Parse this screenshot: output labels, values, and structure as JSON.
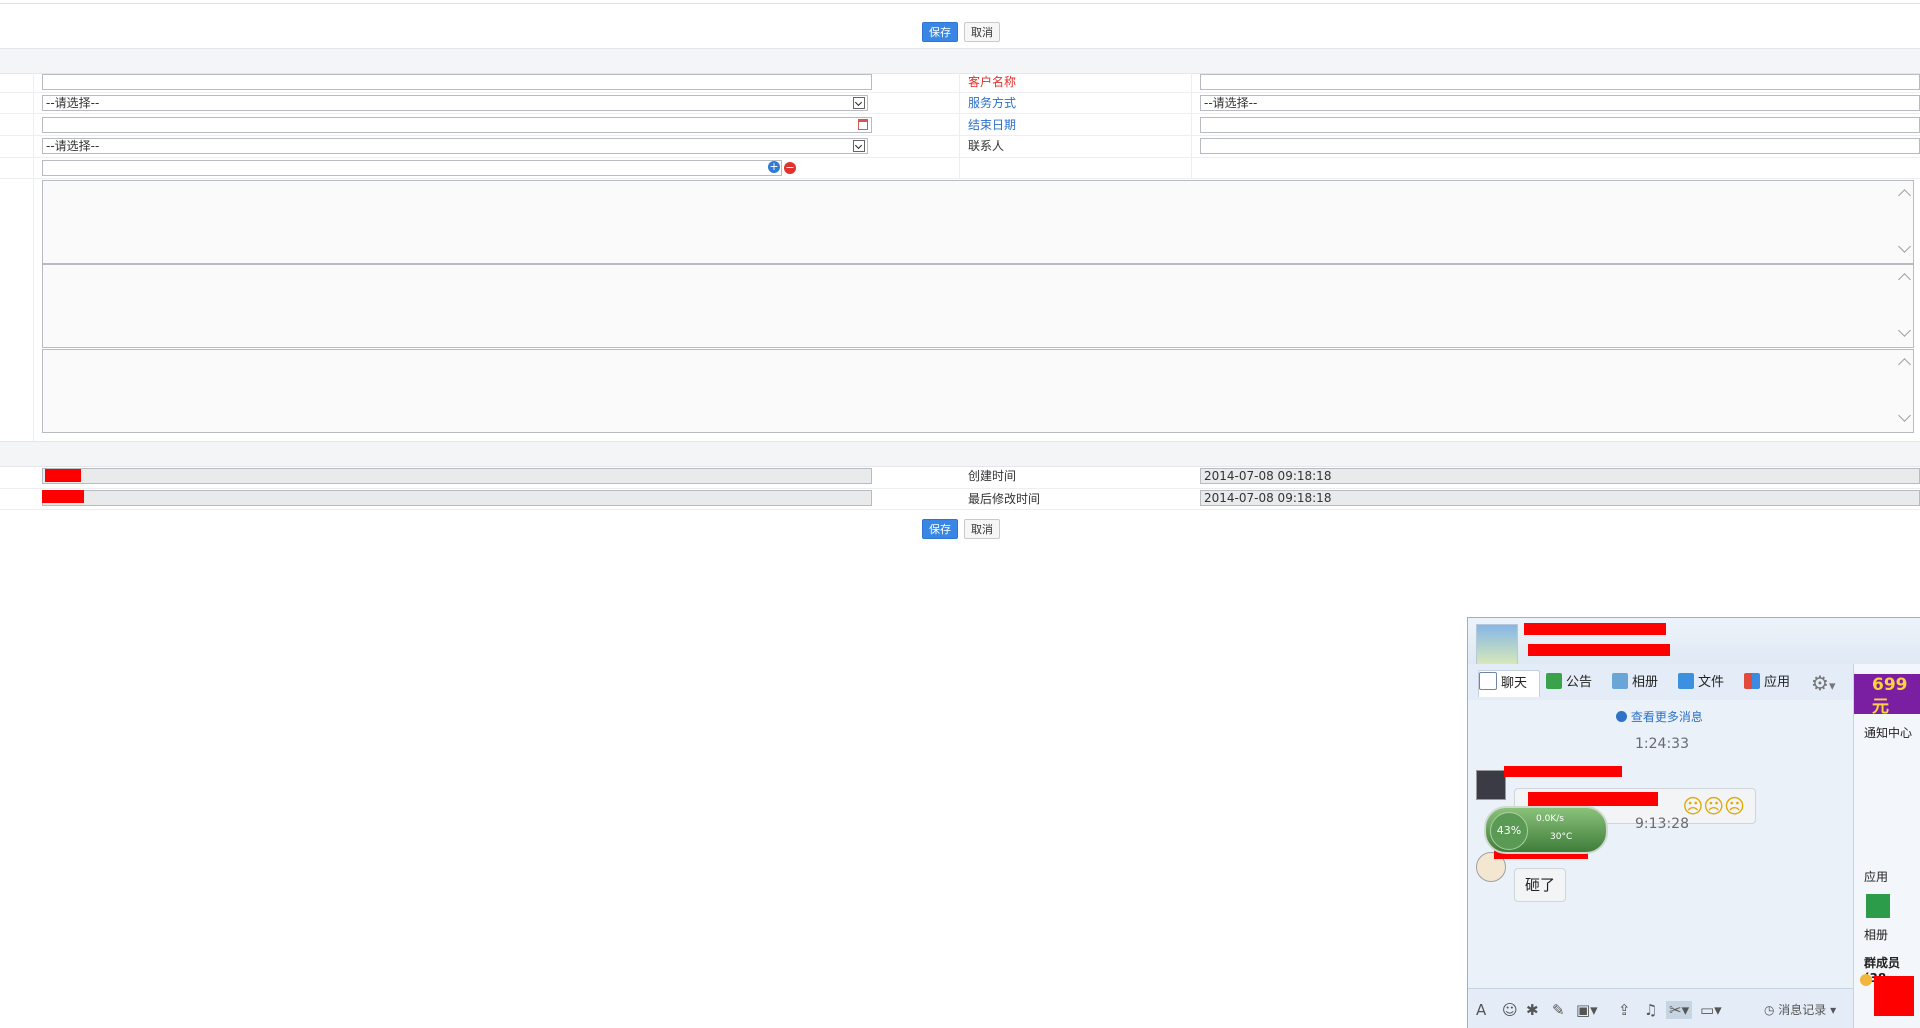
{
  "top_actions": {
    "save": "保存",
    "cancel": "取消"
  },
  "bottom_actions": {
    "save": "保存",
    "cancel": "取消"
  },
  "form": {
    "customer_name_label": "客户名称",
    "service_method_label": "服务方式",
    "service_method_value": "--请选择--",
    "end_date_label": "结束日期",
    "contact_label": "联系人",
    "left_select_1_value": "--请选择--",
    "left_select_2_value": "--请选择--"
  },
  "meta": {
    "created_time_label": "创建时间",
    "created_time_value": "2014-07-08 09:18:18",
    "modified_time_label": "最后修改时间",
    "modified_time_value": "2014-07-08 09:18:18"
  },
  "chat": {
    "tabs": [
      "聊天",
      "公告",
      "相册",
      "文件",
      "应用"
    ],
    "more_messages": "查看更多消息",
    "time_1": "1:24:33",
    "time_2": "9:13:28",
    "message_2": "砸了",
    "history": "消息记录",
    "side_ad": "699元",
    "notify_center": "通知中心",
    "apps_title": "应用",
    "app_album": "相册",
    "members_prefix": "群成员(38",
    "gauge_percent": "43%",
    "gauge_speed": "0.0K/s",
    "gauge_temp": "30°C",
    "emoji_text": "☹☹☹"
  }
}
